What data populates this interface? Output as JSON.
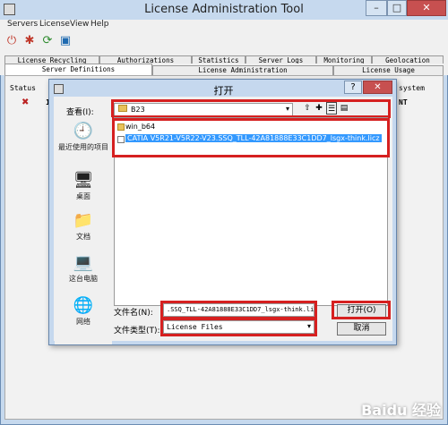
{
  "window": {
    "title": "License Administration Tool"
  },
  "menubar": [
    "Servers",
    "License",
    "View",
    "Help"
  ],
  "toolbar": {
    "icons": [
      "plug-icon",
      "disconnect-icon",
      "refresh-icon",
      "properties-icon"
    ]
  },
  "tabs_row1": [
    "License Recycling",
    "Authorizations",
    "Statistics",
    "Server Logs",
    "Monitoring",
    "Geolocation"
  ],
  "tabs_row2": [
    "Server Definitions",
    "License Administration",
    "License Usage"
  ],
  "table": {
    "col_status": "Status",
    "col_system": "system",
    "row_partial_left": "1",
    "row_partial_right": "NT"
  },
  "dialog": {
    "title": "打开",
    "help": "?",
    "close": "✕",
    "lookin_label": "查看(I):",
    "lookin_value": "B23",
    "places": [
      "最近使用的项目",
      "桌面",
      "文档",
      "这台电脑",
      "网络"
    ],
    "files": [
      {
        "name": "win_b64",
        "type": "folder"
      },
      {
        "name": "CATIA V5R21-V5R22-V23.SSQ_TLL-42A81888E33C1DD7_lsgx-think.licz",
        "type": "file",
        "selected": true
      }
    ],
    "filename_label": "文件名(N):",
    "filename_value": ".SSQ_TLL-42A81888E33C1DD7_lsgx-think.licz",
    "filetype_label": "文件类型(T):",
    "filetype_value": "License Files",
    "open_button": "打开(O)",
    "cancel_button": "取消"
  },
  "watermark": "Baidu 经验",
  "colors": {
    "highlight": "#d62020",
    "selection": "#3399ff",
    "titlebar": "#c6d9ee"
  }
}
